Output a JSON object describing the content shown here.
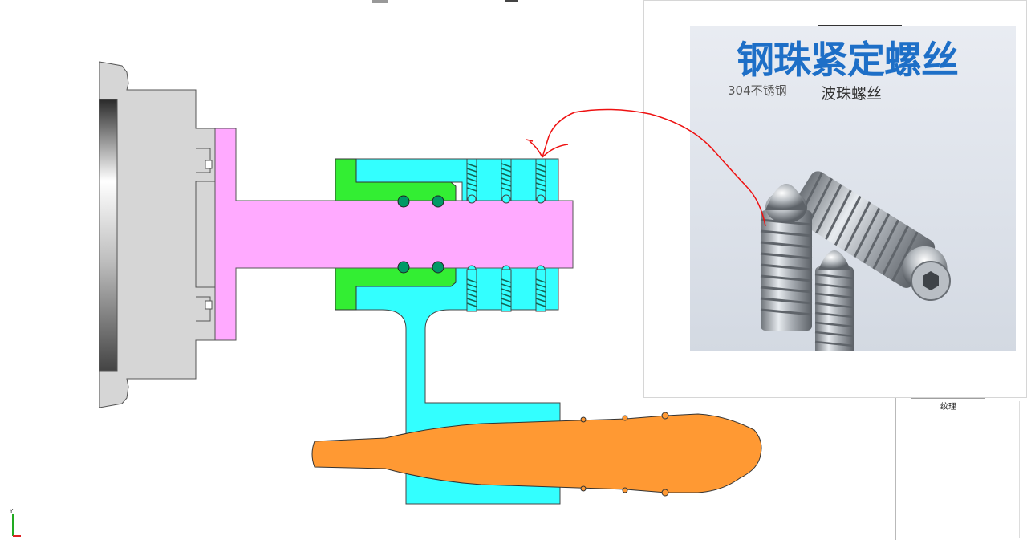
{
  "photo": {
    "title": "钢珠紧定螺丝",
    "subtitle_material": "304不锈钢",
    "subtitle_name": "波珠螺丝"
  },
  "side_panel": {
    "texture_tab_label": "纹理"
  },
  "axis_triad": {
    "y_label": "Y"
  },
  "colors": {
    "flange_gray": "#d6d6d6",
    "shaft_pink": "#ffaaff",
    "housing_cyan": "#33ffff",
    "bushing_green": "#33ee33",
    "workpiece_orange": "#ff9933",
    "annotation_red": "#ee1111",
    "photo_title_blue": "#1e6fc7"
  },
  "icons": [
    "ball-plunger-icon",
    "spring-icon",
    "axis-triad-icon",
    "red-arrow-annotation"
  ]
}
